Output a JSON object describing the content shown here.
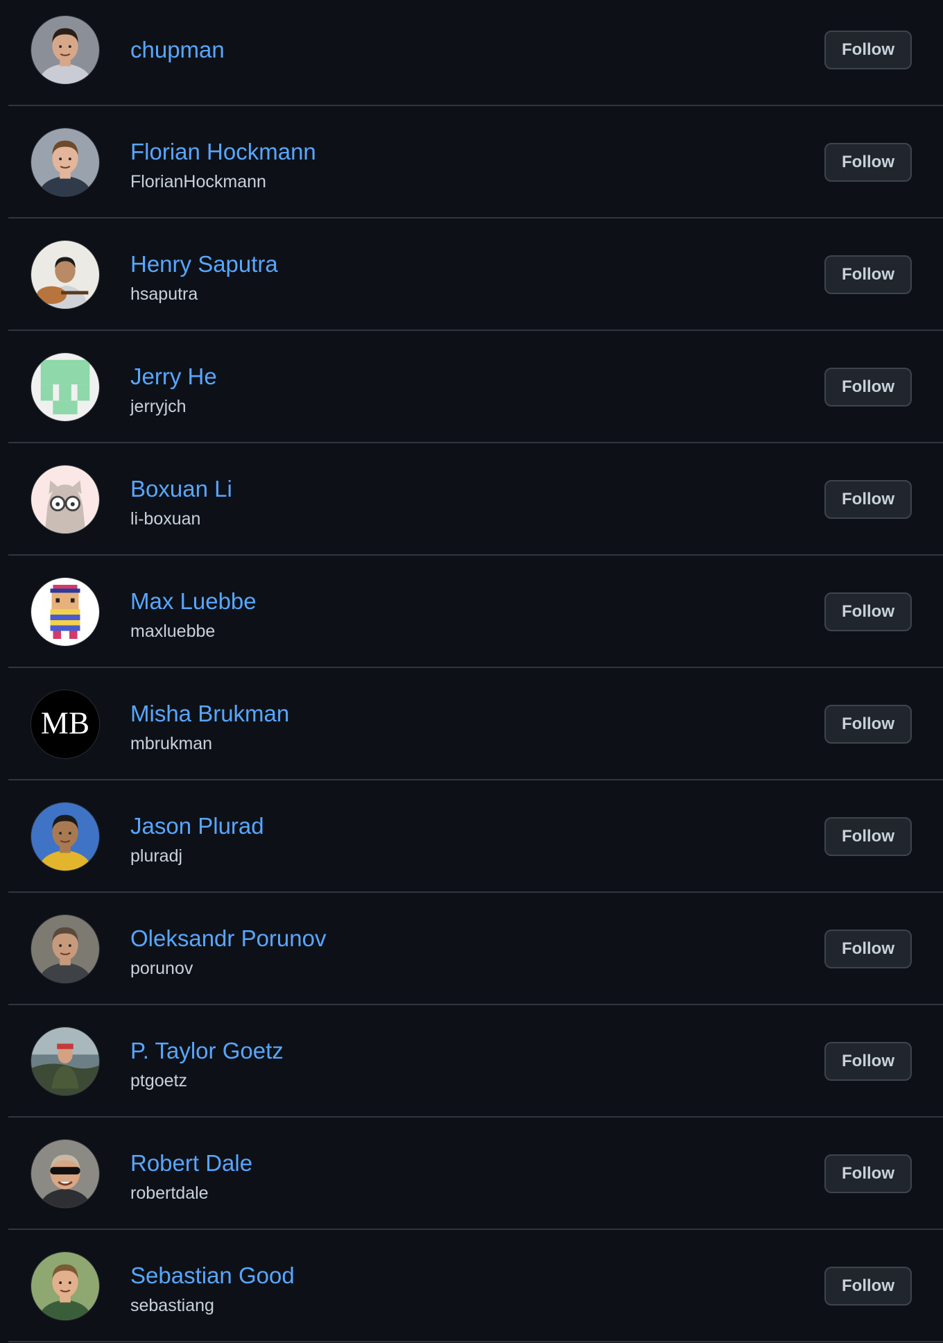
{
  "follow_label": "Follow",
  "colors": {
    "background": "#0d1117",
    "link": "#58a6ff",
    "text": "#c9d1d9",
    "divider": "#30363d",
    "button_bg": "#21262d",
    "button_border": "#3d444d"
  },
  "users": [
    {
      "name": "chupman",
      "login": "",
      "avatar": "photo-avatar"
    },
    {
      "name": "Florian Hockmann",
      "login": "FlorianHockmann",
      "avatar": "photo-avatar"
    },
    {
      "name": "Henry Saputra",
      "login": "hsaputra",
      "avatar": "photo-avatar"
    },
    {
      "name": "Jerry He",
      "login": "jerryjch",
      "avatar": "identicon-avatar"
    },
    {
      "name": "Boxuan Li",
      "login": "li-boxuan",
      "avatar": "cartoon-avatar"
    },
    {
      "name": "Max Luebbe",
      "login": "maxluebbe",
      "avatar": "pixel-art-avatar"
    },
    {
      "name": "Misha Brukman",
      "login": "mbrukman",
      "avatar": "monogram-avatar",
      "avatar_text": "MB"
    },
    {
      "name": "Jason Plurad",
      "login": "pluradj",
      "avatar": "photo-avatar"
    },
    {
      "name": "Oleksandr Porunov",
      "login": "porunov",
      "avatar": "photo-avatar"
    },
    {
      "name": "P. Taylor Goetz",
      "login": "ptgoetz",
      "avatar": "photo-avatar"
    },
    {
      "name": "Robert Dale",
      "login": "robertdale",
      "avatar": "photo-avatar"
    },
    {
      "name": "Sebastian Good",
      "login": "sebastiang",
      "avatar": "photo-avatar"
    }
  ]
}
